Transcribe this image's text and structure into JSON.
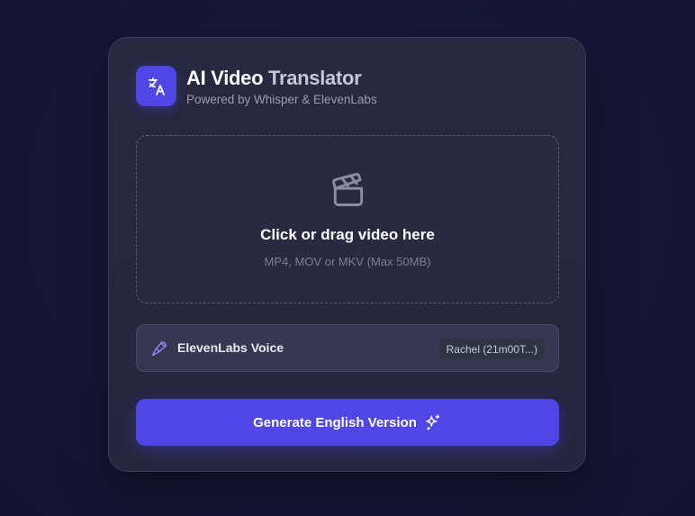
{
  "header": {
    "title_part1": "AI Video",
    "title_part2": "Translator",
    "subtitle": "Powered by Whisper & ElevenLabs",
    "logo_icon": "translate-icon"
  },
  "upload": {
    "icon": "clapperboard-icon",
    "title": "Click or drag video here",
    "hint": "MP4, MOV or MKV (Max 50MB)"
  },
  "voice": {
    "icon": "microphone-icon",
    "label": "ElevenLabs Voice",
    "selected": "Rachel (21m00T...)"
  },
  "action": {
    "label": "Generate English Version",
    "icon": "sparkles-icon"
  },
  "colors": {
    "accent": "#4f46e5",
    "background": "#161737",
    "card": "#26283f"
  }
}
